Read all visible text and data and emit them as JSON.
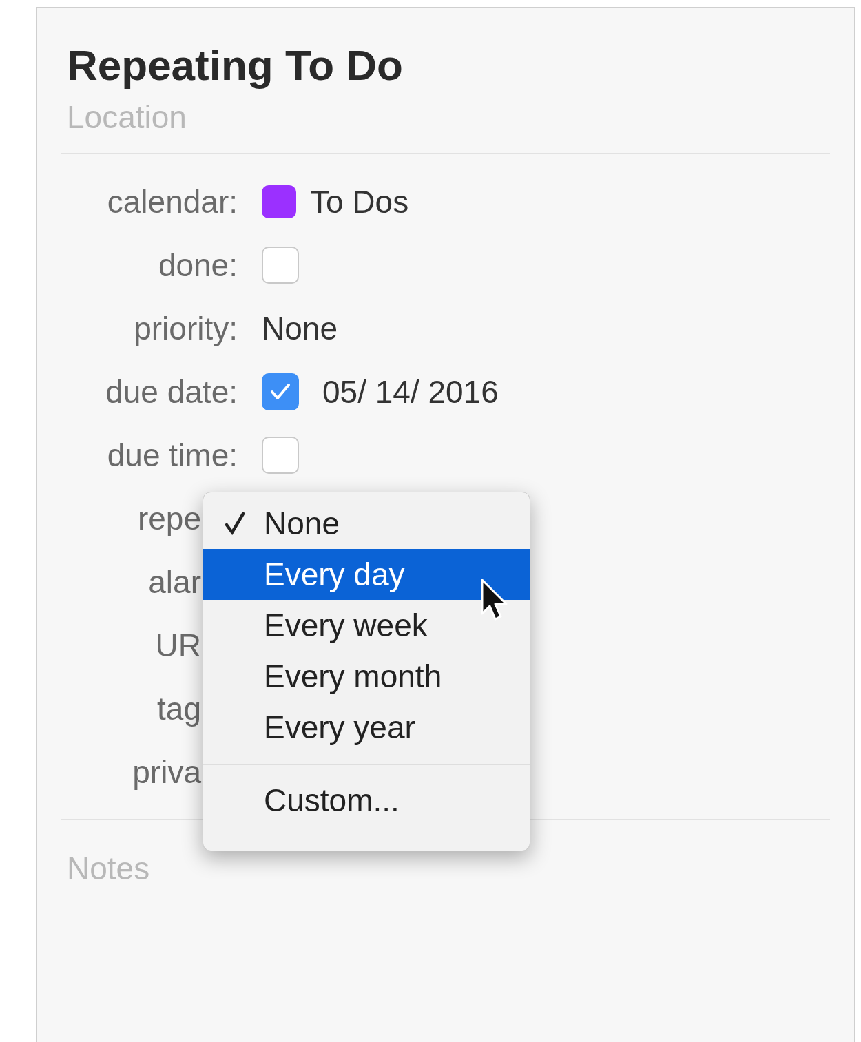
{
  "title": "Repeating To Do",
  "location": {
    "placeholder": "Location"
  },
  "rows": [
    {
      "kind": "calendar",
      "label": "calendar:",
      "cut": false,
      "color": "#9b30ff",
      "value": "To Dos"
    },
    {
      "kind": "checkbox",
      "label": "done:",
      "cut": false,
      "checked": false
    },
    {
      "kind": "text",
      "label": "priority:",
      "cut": false,
      "value": "None"
    },
    {
      "kind": "checkbox",
      "label": "due date:",
      "cut": false,
      "checked": true,
      "value": "05/ 14/ 2016"
    },
    {
      "kind": "checkbox",
      "label": "due time:",
      "cut": false,
      "checked": false
    },
    {
      "kind": "plain",
      "label": "repe",
      "cut": true
    },
    {
      "kind": "plain",
      "label": "alar",
      "cut": true
    },
    {
      "kind": "plain",
      "label": "UR",
      "cut": true
    },
    {
      "kind": "plain",
      "label": "tag",
      "cut": true
    },
    {
      "kind": "plain",
      "label": "priva",
      "cut": true
    }
  ],
  "notes": {
    "placeholder": "Notes"
  },
  "repeat_menu": [
    {
      "kind": "item",
      "label": "None",
      "selected": true,
      "highlighted": false
    },
    {
      "kind": "item",
      "label": "Every day",
      "selected": false,
      "highlighted": true
    },
    {
      "kind": "item",
      "label": "Every week",
      "selected": false,
      "highlighted": false
    },
    {
      "kind": "item",
      "label": "Every month",
      "selected": false,
      "highlighted": false
    },
    {
      "kind": "item",
      "label": "Every year",
      "selected": false,
      "highlighted": false
    },
    {
      "kind": "separator"
    },
    {
      "kind": "item",
      "label": "Custom...",
      "selected": false,
      "highlighted": false
    }
  ]
}
